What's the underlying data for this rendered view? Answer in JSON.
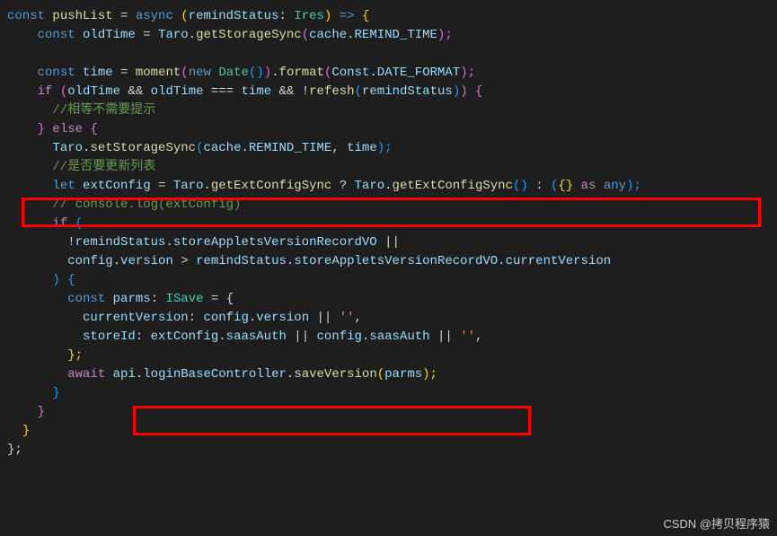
{
  "code": {
    "l1_const": "const",
    "l1_pushList": " pushList ",
    "l1_eq": "= ",
    "l1_async": "async",
    "l1_open": " (",
    "l1_remindStatus": "remindStatus",
    "l1_colon": ": ",
    "l1_Ires": "Ires",
    "l1_close": ") ",
    "l1_arrow": "=>",
    "l1_brace": " {",
    "l2_indent": "    ",
    "l2_const": "const",
    "l2_oldTime": " oldTime ",
    "l2_eq": "= ",
    "l2_Taro": "Taro",
    "l2_dot": ".",
    "l2_getStorageSync": "getStorageSync",
    "l2_open": "(",
    "l2_cache": "cache",
    "l2_dot2": ".",
    "l2_REMIND_TIME": "REMIND_TIME",
    "l2_close": ");",
    "l4_indent": "    ",
    "l4_const": "const",
    "l4_time": " time ",
    "l4_eq": "= ",
    "l4_moment": "moment",
    "l4_open": "(",
    "l4_new": "new",
    "l4_sp": " ",
    "l4_Date": "Date",
    "l4_paren": "()",
    "l4_close": ")",
    "l4_dot": ".",
    "l4_format": "format",
    "l4_open2": "(",
    "l4_Const": "Const",
    "l4_dot2": ".",
    "l4_DATE_FORMAT": "DATE_FORMAT",
    "l4_close2": ");",
    "l5_indent": "    ",
    "l5_if": "if",
    "l5_sp": " ",
    "l5_open": "(",
    "l5_oldTime": "oldTime ",
    "l5_and": "&&",
    "l5_oldTime2": " oldTime ",
    "l5_eqeq": "===",
    "l5_time": " time ",
    "l5_and2": "&&",
    "l5_sp2": " ",
    "l5_not": "!",
    "l5_refesh": "refesh",
    "l5_open2": "(",
    "l5_remindStatus": "remindStatus",
    "l5_close2": ")",
    "l5_close": ") {",
    "l6_comment": "      //相等不需要提示",
    "l7_indent": "    ",
    "l7_close": "}",
    "l7_else": " else {",
    "l8_indent": "      ",
    "l8_Taro": "Taro",
    "l8_dot": ".",
    "l8_setStorageSync": "setStorageSync",
    "l8_open": "(",
    "l8_cache": "cache",
    "l8_dot2": ".",
    "l8_REMIND_TIME": "REMIND_TIME",
    "l8_comma": ", ",
    "l8_time": "time",
    "l8_close": ");",
    "l9_comment": "      //是否要更新列表",
    "l10_indent": "      ",
    "l10_let": "let",
    "l10_extConfig": " extConfig ",
    "l10_eq": "= ",
    "l10_Taro": "Taro",
    "l10_dot": ".",
    "l10_getExtConfigSync": "getExtConfigSync",
    "l10_sp": " ",
    "l10_q": "? ",
    "l10_Taro2": "Taro",
    "l10_dot2": ".",
    "l10_getExtConfigSync2": "getExtConfigSync",
    "l10_paren": "() ",
    "l10_colon": ": ",
    "l10_open": "(",
    "l10_braces": "{} ",
    "l10_as": "as",
    "l10_sp2": " ",
    "l10_any": "any",
    "l10_close": ");",
    "l11_comment": "      // console.log(extConfig)",
    "l12_indent": "      ",
    "l12_if": "if",
    "l12_open": " (",
    "l13_indent": "        ",
    "l13_not": "!",
    "l13_remindStatus": "remindStatus",
    "l13_dot": ".",
    "l13_storeAppletsVersionRecordVO": "storeAppletsVersionRecordVO",
    "l13_or": " ||",
    "l14_indent": "        ",
    "l14_config": "config",
    "l14_dot": ".",
    "l14_version": "version ",
    "l14_gt": "> ",
    "l14_remindStatus": "remindStatus",
    "l14_dot2": ".",
    "l14_storeAppletsVersionRecordVO": "storeAppletsVersionRecordVO",
    "l14_dot3": ".",
    "l14_currentVersion": "currentVersion",
    "l15_indent": "      ",
    "l15_close": ") {",
    "l16_indent": "        ",
    "l16_const": "const",
    "l16_parms": " parms",
    "l16_colon": ": ",
    "l16_ISave": "ISave",
    "l16_eq": " = {",
    "l17_indent": "          ",
    "l17_currentVersion": "currentVersion",
    "l17_colon": ": ",
    "l17_config": "config",
    "l17_dot": ".",
    "l17_version": "version ",
    "l17_or": "|| ",
    "l17_str": "''",
    "l17_comma": ",",
    "l18_indent": "          ",
    "l18_storeId": "storeId",
    "l18_colon": ": ",
    "l18_extConfig": "extConfig",
    "l18_dot": ".",
    "l18_saasAuth": "saasAuth ",
    "l18_or": "|| ",
    "l18_config": "config",
    "l18_dot2": ".",
    "l18_saasAuth2": "saasAuth ",
    "l18_or2": "|| ",
    "l18_str": "''",
    "l18_comma": ",",
    "l19_indent": "        ",
    "l19_close": "};",
    "l20_indent": "        ",
    "l20_await": "await",
    "l20_sp": " ",
    "l20_api": "api",
    "l20_dot": ".",
    "l20_loginBaseController": "loginBaseController",
    "l20_dot2": ".",
    "l20_saveVersion": "saveVersion",
    "l20_open": "(",
    "l20_parms": "parms",
    "l20_close": ");",
    "l21_close": "      }",
    "l22_close": "    }",
    "l23_close": "  }",
    "l24_close": "};"
  },
  "watermark": "CSDN @拷贝程序猿"
}
